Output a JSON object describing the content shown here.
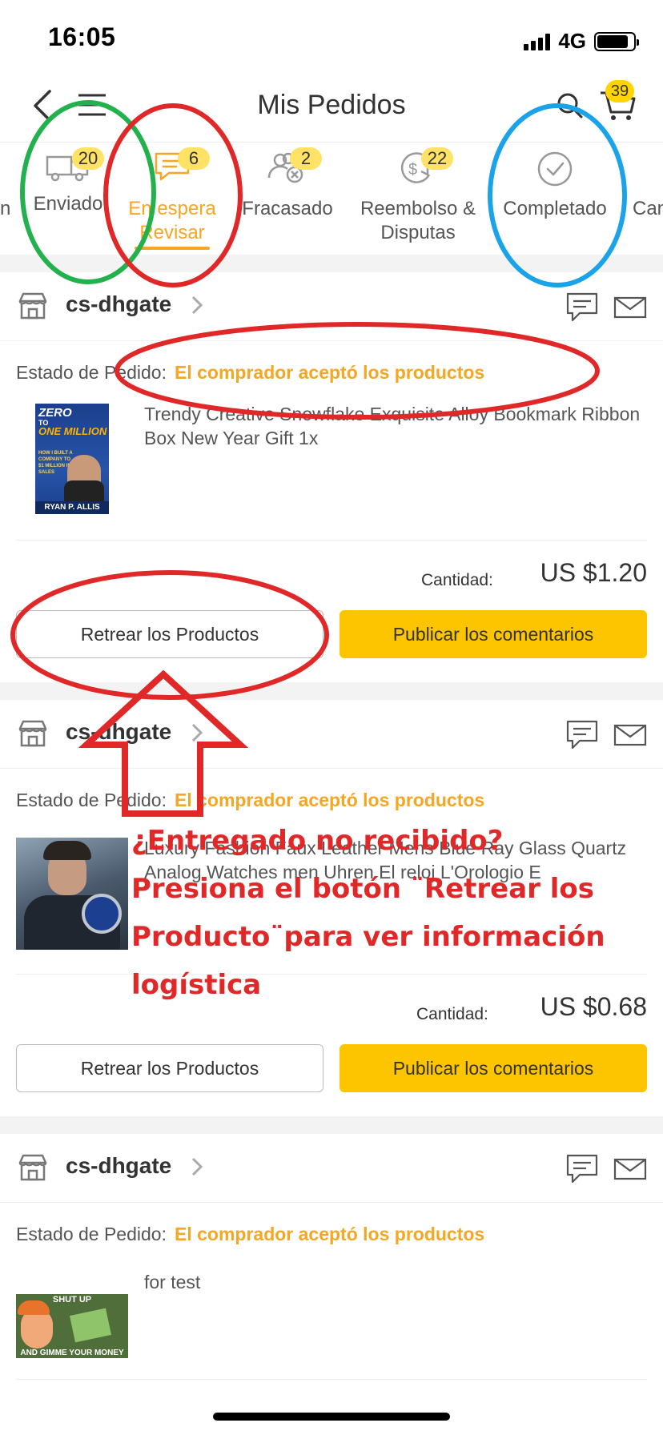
{
  "status_bar": {
    "time": "16:05",
    "network": "4G"
  },
  "nav": {
    "title": "Mis Pedidos",
    "cart_count": "39"
  },
  "tabs": [
    {
      "label": "Enviado",
      "badge": "20",
      "icon": "truck-icon"
    },
    {
      "label": "En espera Revisar",
      "badge": "6",
      "icon": "comment-icon",
      "active": true
    },
    {
      "label": "Fracasado",
      "badge": "2",
      "icon": "failed-users-icon"
    },
    {
      "label": "Reembolso & Disputas",
      "badge": "22",
      "icon": "refund-icon"
    },
    {
      "label": "Completado",
      "badge": "",
      "icon": "check-circle-icon"
    },
    {
      "label": "Can",
      "badge": "",
      "icon": ""
    }
  ],
  "orders": [
    {
      "store": "cs-dhgate",
      "status_label": "Estado de Pedido:",
      "status_value": "El comprador aceptó los productos",
      "product_title": "Trendy Creative Snowflake Exquisite Alloy Bookmark Ribbon Box New Year Gift 1x",
      "book_cover": {
        "line1": "ZERO",
        "line2": "TO",
        "line3": "ONE MILLION",
        "line4": "HOW I BUILT A COMPANY TO $1 MILLION IN SALES",
        "author": "RYAN P. ALLIS"
      },
      "qty_label": "Cantidad:",
      "price": "US $1.20",
      "track_label": "Retrear los Productos",
      "review_label": "Publicar los comentarios"
    },
    {
      "store": "cs-dhgate",
      "status_label": "Estado de Pedido:",
      "status_value": "El comprador aceptó los productos",
      "product_title": "Luxury Fashion Faux Leather Mens Blue Ray Glass Quartz Analog Watches men Uhren El reloj L'Orologio E",
      "qty_label": "Cantidad:",
      "price": "US $0.68",
      "track_label": "Retrear los Productos",
      "review_label": "Publicar los comentarios"
    },
    {
      "store": "cs-dhgate",
      "status_label": "Estado de Pedido:",
      "status_value": "El comprador aceptó los productos",
      "product_title": "for test",
      "meme_top": "SHUT UP",
      "meme_bottom": "AND GIMME YOUR MONEY"
    }
  ],
  "annotation": {
    "line1": "¿Entregado no recibido?",
    "line2": "Presiona el botón ¨Retrear los",
    "line3": "Producto¨para ver información",
    "line4": "logística"
  },
  "colors": {
    "accent": "#f5a623",
    "button_yellow": "#fdc400",
    "badge_yellow": "#ffe266",
    "annotation_red": "#e02828",
    "annotation_green": "#22b14c",
    "annotation_blue": "#1aa3e8"
  }
}
